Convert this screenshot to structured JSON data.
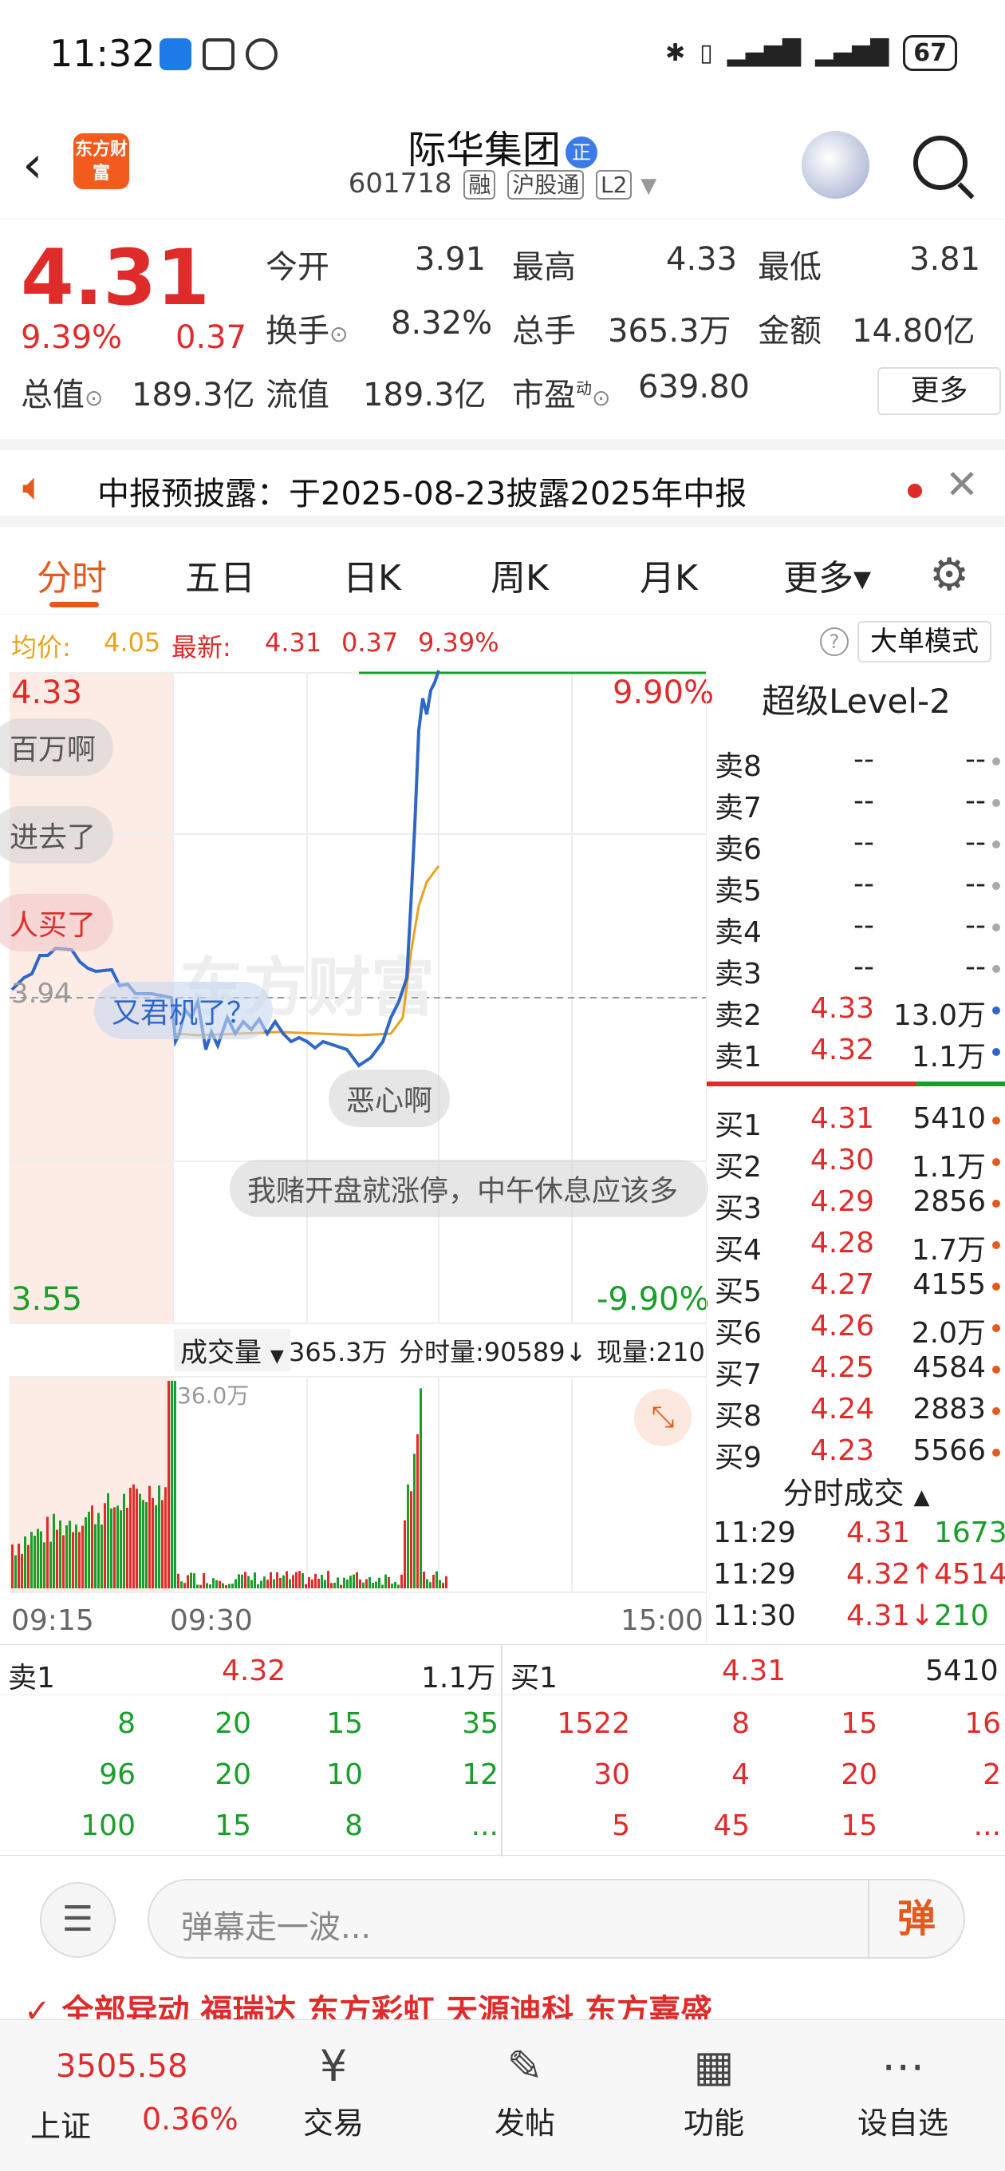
{
  "status": {
    "time": "11:32",
    "battery": "67"
  },
  "header": {
    "logo": "东方财富",
    "title": "际华集团",
    "title_badge": "正",
    "code": "601718",
    "tags": [
      "融",
      "沪股通",
      "L2"
    ]
  },
  "quote": {
    "price": "4.31",
    "pct": "9.39%",
    "chg": "0.37",
    "open_label": "今开",
    "open": "3.91",
    "high_label": "最高",
    "high": "4.33",
    "low_label": "最低",
    "low": "3.81",
    "turnover_label": "换手",
    "turnover": "8.32%",
    "vol_label": "总手",
    "vol": "365.3万",
    "amount_label": "金额",
    "amount": "14.80亿",
    "mcap_label": "总值",
    "mcap": "189.3亿",
    "float_label": "流值",
    "float": "189.3亿",
    "pe_label": "市盈",
    "pe_sup": "动",
    "pe": "639.80",
    "more": "更多"
  },
  "notice": {
    "text": "中报预披露：于2025-08-23披露2025年中报"
  },
  "tabs": [
    "分时",
    "五日",
    "日K",
    "周K",
    "月K",
    "更多▾"
  ],
  "infoline": {
    "avg_label": "均价:",
    "avg": "4.05",
    "latest_label": "最新:",
    "latest": "4.31",
    "chg": "0.37",
    "pct": "9.39%",
    "bigmode": "大单模式"
  },
  "chart": {
    "top_price": "4.33",
    "bottom_price": "3.55",
    "mid_price": "3.94",
    "top_pct": "9.90%",
    "bottom_pct": "-9.90%",
    "vol_select": "成交量",
    "vol_total": "365.3万",
    "minute_vol": "分时量:90589↓",
    "cur_vol": "现量:210",
    "vol_max": "36.0万",
    "time_start": "09:15",
    "time_open": "09:30",
    "time_end": "15:00",
    "danmu": [
      "百万啊",
      "进去了",
      "人买了",
      "又君机了？",
      "恶心啊",
      "我赌开盘就涨停，中午休息应该多"
    ],
    "watermark": "东方财富"
  },
  "book": {
    "title": "超级Level-2",
    "asks": [
      {
        "l": "卖8",
        "p": "--",
        "v": "--"
      },
      {
        "l": "卖7",
        "p": "--",
        "v": "--"
      },
      {
        "l": "卖6",
        "p": "--",
        "v": "--"
      },
      {
        "l": "卖5",
        "p": "--",
        "v": "--"
      },
      {
        "l": "卖4",
        "p": "--",
        "v": "--"
      },
      {
        "l": "卖3",
        "p": "--",
        "v": "--"
      },
      {
        "l": "卖2",
        "p": "4.33",
        "v": "13.0万"
      },
      {
        "l": "卖1",
        "p": "4.32",
        "v": "1.1万"
      }
    ],
    "bids": [
      {
        "l": "买1",
        "p": "4.31",
        "v": "5410"
      },
      {
        "l": "买2",
        "p": "4.30",
        "v": "1.1万"
      },
      {
        "l": "买3",
        "p": "4.29",
        "v": "2856"
      },
      {
        "l": "买4",
        "p": "4.28",
        "v": "1.7万"
      },
      {
        "l": "买5",
        "p": "4.27",
        "v": "4155"
      },
      {
        "l": "买6",
        "p": "4.26",
        "v": "2.0万"
      },
      {
        "l": "买7",
        "p": "4.25",
        "v": "4584"
      },
      {
        "l": "买8",
        "p": "4.24",
        "v": "2883"
      },
      {
        "l": "买9",
        "p": "4.23",
        "v": "5566"
      }
    ],
    "trades_title": "分时成交",
    "trades": [
      {
        "t": "11:29",
        "p": "4.31",
        "v": "1673"
      },
      {
        "t": "11:29",
        "p": "4.32↑",
        "v": "4514"
      },
      {
        "t": "11:30",
        "p": "4.31↓",
        "v": "210"
      }
    ]
  },
  "orders": {
    "left": {
      "label": "卖1",
      "price": "4.32",
      "vol": "1.1万",
      "rows": [
        [
          "8",
          "20",
          "15",
          "35"
        ],
        [
          "96",
          "20",
          "10",
          "12"
        ],
        [
          "100",
          "15",
          "8",
          "..."
        ]
      ]
    },
    "right": {
      "label": "买1",
      "price": "4.31",
      "vol": "5410",
      "rows": [
        [
          "1522",
          "8",
          "15",
          "16"
        ],
        [
          "30",
          "4",
          "20",
          "2"
        ],
        [
          "5",
          "45",
          "15",
          "..."
        ]
      ]
    }
  },
  "comment": {
    "placeholder": "弹幕走一波...",
    "dan": "弹"
  },
  "hot": "✓ 全部异动 福瑞达 东方彩虹 天源迪科 东方嘉盛",
  "nav": {
    "index_value": "3505.58",
    "index_name": "上证",
    "index_pct": "0.36%",
    "items": [
      "交易",
      "发帖",
      "功能",
      "设自选"
    ]
  }
}
